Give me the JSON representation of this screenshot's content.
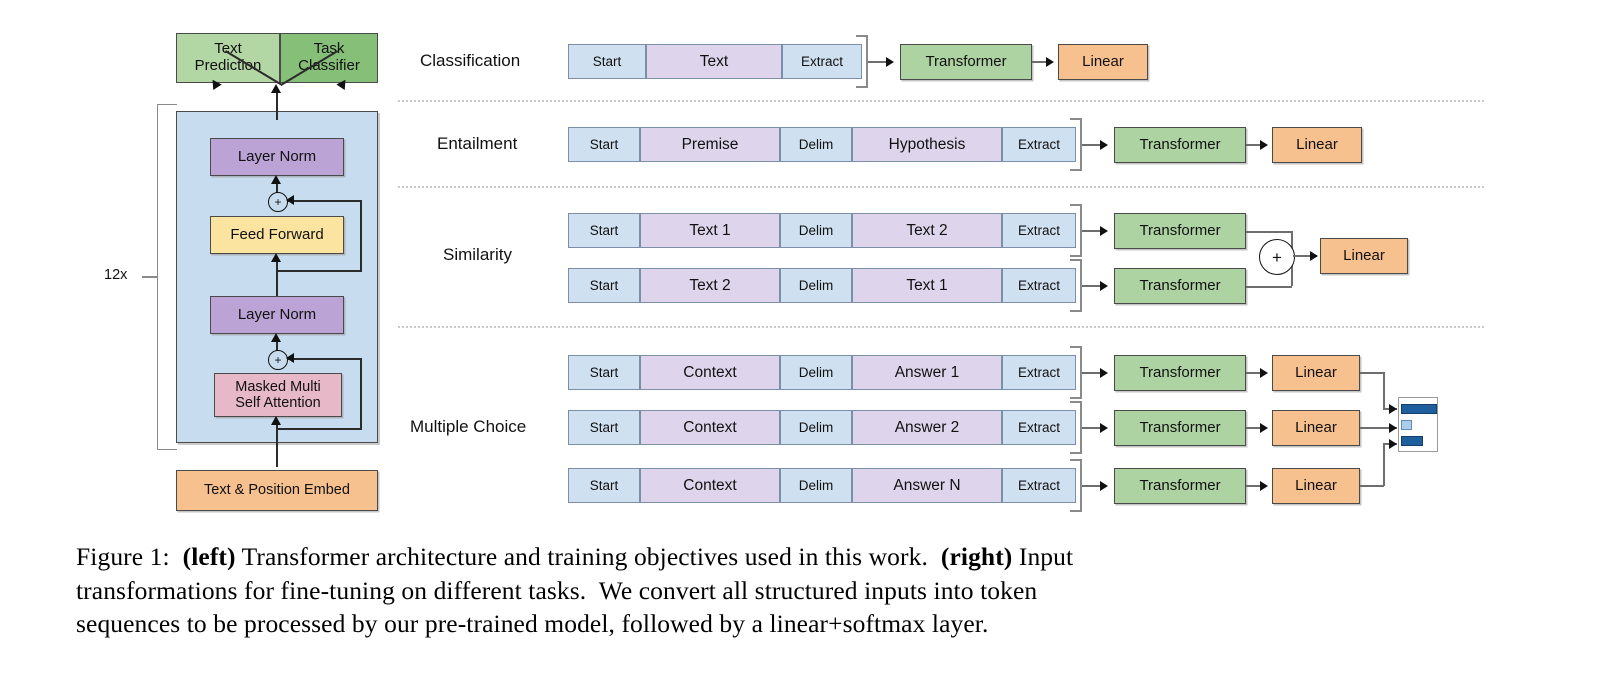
{
  "figure": {
    "caption_lines": [
      "Figure 1:  (left) Transformer architecture and training objectives used in this work.  (right) Input",
      "transformations for fine-tuning on different tasks.  We convert all structured inputs into token",
      "sequences to be processed by our pre-trained model, followed by a linear+softmax layer."
    ],
    "caption_label": "Figure 1:",
    "bold_left": "(left)",
    "bold_right": "(right)",
    "caption_part1": "Transformer architecture and training objectives used in this work.",
    "caption_part2": "Input transformations for fine-tuning on different tasks. We convert all structured inputs into token sequences to be processed by our pre-trained model, followed by a linear+softmax layer."
  },
  "left_diagram": {
    "heads": [
      {
        "label": "Text\nPrediction",
        "color": "#b3d6a5"
      },
      {
        "label": "Task\nClassifier",
        "color": "#86bf78"
      }
    ],
    "head_text_prediction": "Text Prediction",
    "head_task_classifier": "Task Classifier",
    "repeat_label": "12x",
    "blocks": [
      {
        "name": "layer-norm-top",
        "label": "Layer Norm",
        "color": "#bba3d6"
      },
      {
        "name": "feed-forward",
        "label": "Feed Forward",
        "color": "#fbe4a0"
      },
      {
        "name": "layer-norm-bot",
        "label": "Layer Norm",
        "color": "#bba3d6"
      },
      {
        "name": "masked-attn",
        "label": "Masked Multi Self Attention",
        "color": "#e7b8c8"
      }
    ],
    "layer_norm_top": "Layer Norm",
    "feed_forward": "Feed Forward",
    "layer_norm_bottom": "Layer Norm",
    "masked_attn_line1": "Masked Multi",
    "masked_attn_line2": "Self Attention",
    "embed": "Text & Position Embed",
    "residual_symbol": "+",
    "panel_color": "#c8dcef"
  },
  "tasks": [
    {
      "name": "classification",
      "label": "Classification",
      "rows": [
        {
          "tokens": [
            "Start",
            "Text",
            "Extract"
          ],
          "transformer": "Transformer",
          "linear": "Linear"
        }
      ]
    },
    {
      "name": "entailment",
      "label": "Entailment",
      "rows": [
        {
          "tokens": [
            "Start",
            "Premise",
            "Delim",
            "Hypothesis",
            "Extract"
          ],
          "transformer": "Transformer",
          "linear": "Linear"
        }
      ]
    },
    {
      "name": "similarity",
      "label": "Similarity",
      "rows": [
        {
          "tokens": [
            "Start",
            "Text 1",
            "Delim",
            "Text 2",
            "Extract"
          ],
          "transformer": "Transformer"
        },
        {
          "tokens": [
            "Start",
            "Text 2",
            "Delim",
            "Text 1",
            "Extract"
          ],
          "transformer": "Transformer"
        }
      ],
      "combiner": "+",
      "linear": "Linear"
    },
    {
      "name": "multiple-choice",
      "label": "Multiple Choice",
      "rows": [
        {
          "tokens": [
            "Start",
            "Context",
            "Delim",
            "Answer 1",
            "Extract"
          ],
          "transformer": "Transformer",
          "linear": "Linear"
        },
        {
          "tokens": [
            "Start",
            "Context",
            "Delim",
            "Answer 2",
            "Extract"
          ],
          "transformer": "Transformer",
          "linear": "Linear"
        },
        {
          "tokens": [
            "Start",
            "Context",
            "Delim",
            "Answer N",
            "Extract"
          ],
          "transformer": "Transformer",
          "linear": "Linear"
        }
      ]
    }
  ],
  "token_labels": {
    "start": "Start",
    "text": "Text",
    "extract": "Extract",
    "delim": "Delim",
    "premise": "Premise",
    "hypothesis": "Hypothesis",
    "text1": "Text 1",
    "text2": "Text 2",
    "context": "Context",
    "answer1": "Answer 1",
    "answer2": "Answer 2",
    "answerN": "Answer N",
    "transformer": "Transformer",
    "linear": "Linear"
  },
  "colors": {
    "token_blue": "#cfe0f1",
    "token_purple": "#ded5ec",
    "transformer_green": "#aed3a3",
    "linear_orange": "#f7c08f",
    "layernorm_purple": "#bba3d6",
    "feedforward_yellow": "#fbe4a0",
    "attention_pink": "#e7b8c8",
    "panel_blue": "#c8dcef",
    "head_green_light": "#b3d6a5",
    "head_green_dark": "#86bf78",
    "softmax_bar": "#1f5f9e",
    "softmax_bar_light": "#a9cdea"
  },
  "softmax_chart": {
    "name": "softmax-output",
    "bars": [
      0.95,
      0.22,
      0.55
    ]
  }
}
